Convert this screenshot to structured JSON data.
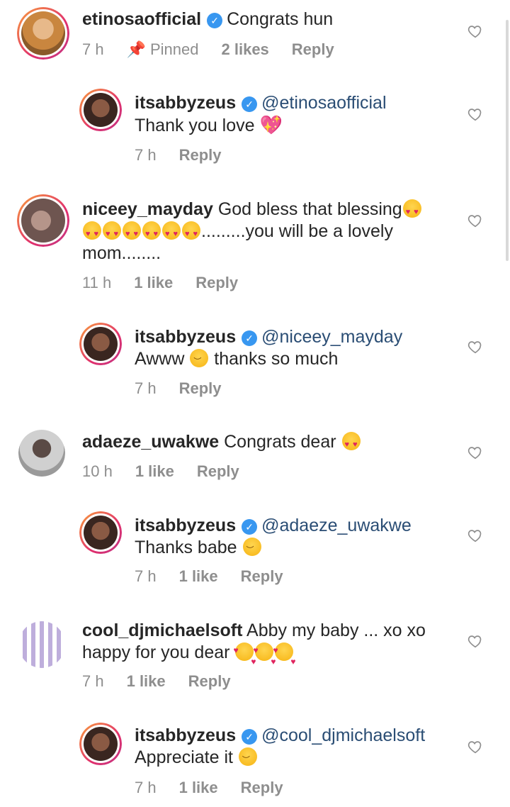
{
  "comments": [
    {
      "username": "etinosaofficial",
      "verified": true,
      "text": "Congrats hun",
      "time": "7 h",
      "pinned": "Pinned",
      "likes": "2 likes",
      "reply": "Reply",
      "avatar_color": "#c9863f"
    },
    {
      "username": "itsabbyzeus",
      "verified": true,
      "mention": "@etinosaofficial",
      "text": "Thank you love",
      "time": "7 h",
      "reply": "Reply",
      "avatar_color": "#5b3a2e"
    },
    {
      "username": "niceey_mayday",
      "text_line1": "God bless that blessing",
      "text_line2": ".........you will be a lovely",
      "text_line3": "mom........",
      "time": "11 h",
      "likes": "1 like",
      "reply": "Reply",
      "avatar_color": "#6e5550"
    },
    {
      "username": "itsabbyzeus",
      "verified": true,
      "mention": "@niceey_mayday",
      "text_a": "Awww",
      "text_b": "thanks so much",
      "time": "7 h",
      "reply": "Reply",
      "avatar_color": "#5b3a2e"
    },
    {
      "username": "adaeze_uwakwe",
      "text": "Congrats dear",
      "time": "10 h",
      "likes": "1 like",
      "reply": "Reply",
      "avatar_color": "#9a9a9a"
    },
    {
      "username": "itsabbyzeus",
      "verified": true,
      "mention": "@adaeze_uwakwe",
      "text": "Thanks babe",
      "time": "7 h",
      "likes": "1 like",
      "reply": "Reply",
      "avatar_color": "#5b3a2e"
    },
    {
      "username": "cool_djmichaelsoft",
      "text_line1": "Abby my baby ... xo xo",
      "text_line2": "happy for you dear",
      "time": "7 h",
      "likes": "1 like",
      "reply": "Reply",
      "avatar_color": "#b7a6d9"
    },
    {
      "username": "itsabbyzeus",
      "verified": true,
      "mention": "@cool_djmichaelsoft",
      "text": "Appreciate it",
      "time": "7 h",
      "likes": "1 like",
      "reply": "Reply",
      "avatar_color": "#5b3a2e"
    }
  ],
  "colors": {
    "mention": "#2a4d74",
    "verified": "#3897f0",
    "meta": "#8e8e8e"
  },
  "icons": {
    "heart": "heart-outline-icon",
    "pin": "pin-icon",
    "verified": "verified-badge-icon"
  }
}
